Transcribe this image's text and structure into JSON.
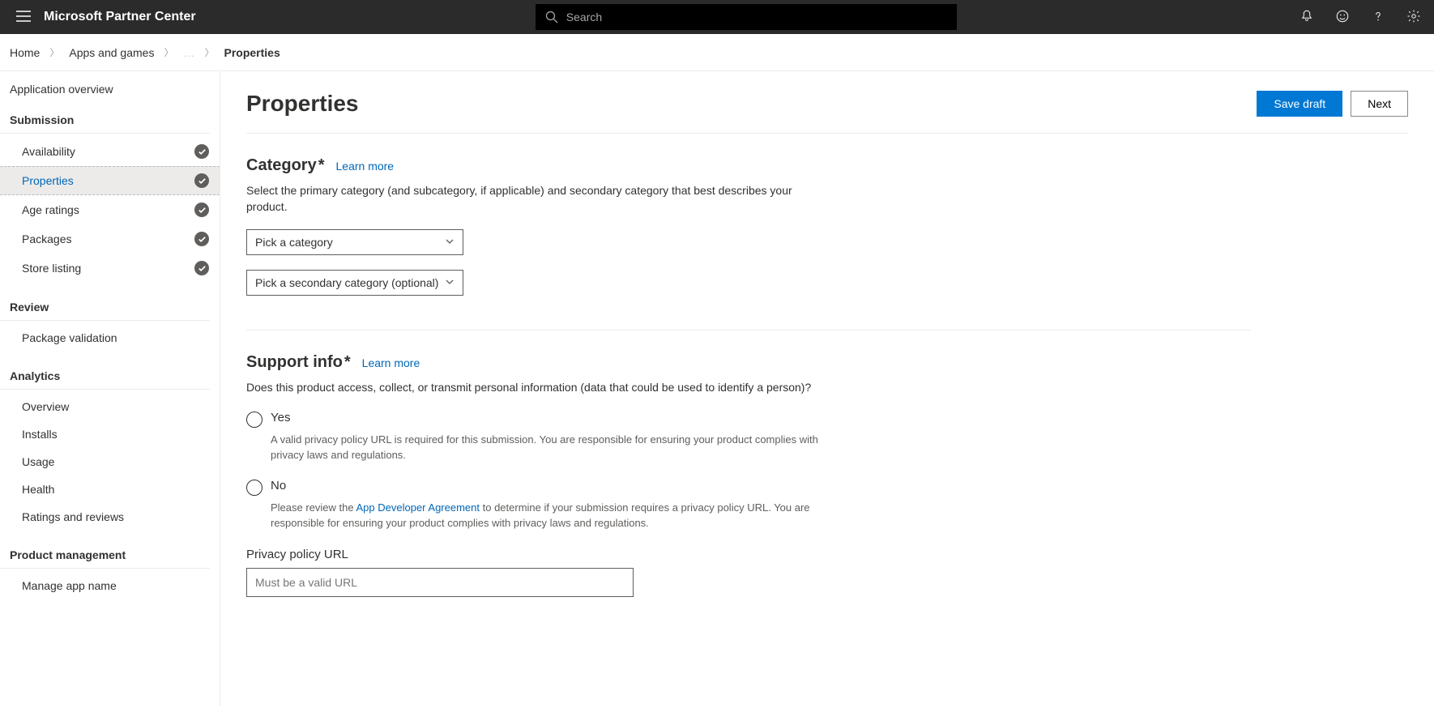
{
  "header": {
    "brand": "Microsoft Partner Center",
    "search_placeholder": "Search"
  },
  "breadcrumb": {
    "home": "Home",
    "apps": "Apps and games",
    "current": "Properties"
  },
  "sidebar": {
    "overview": "Application overview",
    "groups": {
      "submission": {
        "heading": "Submission",
        "items": [
          "Availability",
          "Properties",
          "Age ratings",
          "Packages",
          "Store listing"
        ]
      },
      "review": {
        "heading": "Review",
        "items": [
          "Package validation"
        ]
      },
      "analytics": {
        "heading": "Analytics",
        "items": [
          "Overview",
          "Installs",
          "Usage",
          "Health",
          "Ratings and reviews"
        ]
      },
      "product_mgmt": {
        "heading": "Product management",
        "items": [
          "Manage app name"
        ]
      }
    }
  },
  "main": {
    "title": "Properties",
    "save_draft": "Save draft",
    "next": "Next",
    "category": {
      "heading": "Category",
      "learn_more": "Learn more",
      "desc": "Select the primary category (and subcategory, if applicable) and secondary category that best describes your product.",
      "primary_placeholder": "Pick a category",
      "secondary_placeholder": "Pick a secondary category (optional)"
    },
    "support": {
      "heading": "Support info",
      "learn_more": "Learn more",
      "question": "Does this product access, collect, or transmit personal information (data that could be used to identify a person)?",
      "yes_label": "Yes",
      "yes_help": "A valid privacy policy URL is required for this submission. You are responsible for ensuring your product complies with privacy laws and regulations.",
      "no_label": "No",
      "no_help_prefix": "Please review the ",
      "no_help_link": "App Developer Agreement",
      "no_help_suffix": " to determine if your submission requires a privacy policy URL. You are responsible for ensuring your product complies with privacy laws and regulations.",
      "privacy_label": "Privacy policy URL",
      "privacy_placeholder": "Must be a valid URL"
    }
  }
}
